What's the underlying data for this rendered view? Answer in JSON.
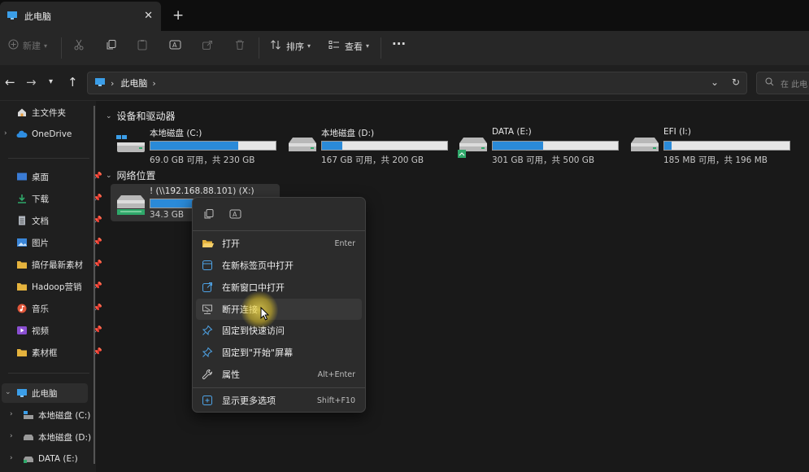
{
  "tab": {
    "title": "此电脑",
    "close": "✕",
    "new": "+"
  },
  "toolbar": {
    "new_label": "新建",
    "sort_label": "排序",
    "view_label": "查看",
    "more": "···"
  },
  "address": {
    "path": "此电脑",
    "search_placeholder": "在 此电"
  },
  "sidebar": {
    "home": "主文件夹",
    "onedrive": "OneDrive",
    "quick": [
      {
        "label": "桌面",
        "color": "#3a7bd5"
      },
      {
        "label": "下载",
        "color": "#2fa86a"
      },
      {
        "label": "文档",
        "color": "#8a8f98"
      },
      {
        "label": "图片",
        "color": "#3a86d9"
      },
      {
        "label": "搞仔最新素材",
        "color": "#e5b33d"
      },
      {
        "label": "Hadoop营销",
        "color": "#e5b33d"
      },
      {
        "label": "音乐",
        "color": "#e0563a"
      },
      {
        "label": "视频",
        "color": "#8a4fd1"
      },
      {
        "label": "素材框",
        "color": "#e5b33d"
      }
    ],
    "thispc": "此电脑",
    "drives": [
      "本地磁盘 (C:)",
      "本地磁盘 (D:)",
      "DATA (E:)"
    ]
  },
  "groups": {
    "devices": "设备和驱动器",
    "network": "网络位置"
  },
  "drives": [
    {
      "name": "本地磁盘 (C:)",
      "info": "69.0 GB 可用，共 230 GB",
      "used": 0.7
    },
    {
      "name": "本地磁盘 (D:)",
      "info": "167 GB 可用，共 200 GB",
      "used": 0.165
    },
    {
      "name": "DATA (E:)",
      "info": "301 GB 可用，共 500 GB",
      "used": 0.4
    },
    {
      "name": "EFI (I:)",
      "info": "185 MB 可用，共 196 MB",
      "used": 0.056
    }
  ],
  "network_drive": {
    "name": "! (\\\\192.168.88.101) (X:)",
    "info": "34.3 GB",
    "used": 0.35
  },
  "context_menu": {
    "items": [
      {
        "label": "打开",
        "shortcut": "Enter"
      },
      {
        "label": "在新标签页中打开",
        "shortcut": ""
      },
      {
        "label": "在新窗口中打开",
        "shortcut": ""
      },
      {
        "label": "断开连接",
        "shortcut": ""
      },
      {
        "label": "固定到快速访问",
        "shortcut": ""
      },
      {
        "label": "固定到\"开始\"屏幕",
        "shortcut": ""
      },
      {
        "label": "属性",
        "shortcut": "Alt+Enter"
      }
    ],
    "more": {
      "label": "显示更多选项",
      "shortcut": "Shift+F10"
    }
  },
  "colors": {
    "accent": "#2a8ad8",
    "background": "#191919",
    "menu": "#2c2c2c"
  }
}
